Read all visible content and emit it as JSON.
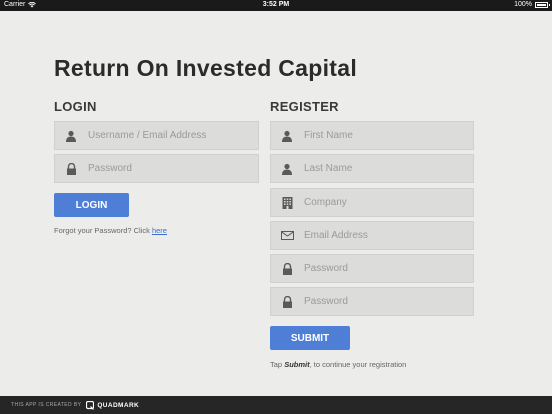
{
  "statusbar": {
    "carrier": "Carrier",
    "time": "3:52 PM",
    "battery": "100%"
  },
  "page": {
    "title": "Return On Invested Capital"
  },
  "login": {
    "heading": "LOGIN",
    "username_placeholder": "Username / Email Address",
    "password_placeholder": "Password",
    "button_label": "LOGIN",
    "forgot_text": "Forgot your Password? Click ",
    "forgot_link": "here"
  },
  "register": {
    "heading": "REGISTER",
    "first_name_placeholder": "First Name",
    "last_name_placeholder": "Last Name",
    "company_placeholder": "Company",
    "email_placeholder": "Email Address",
    "password_placeholder": "Password",
    "confirm_password_placeholder": "Password",
    "button_label": "SUBMIT",
    "hint_prefix": "Tap ",
    "hint_emphasis": "Submit",
    "hint_suffix": ", to continue your registration"
  },
  "footer": {
    "created_by": "THIS APP IS CREATED BY",
    "brand": "QUADMARK"
  },
  "icons": {
    "user": "user-icon",
    "lock": "lock-icon",
    "building": "building-icon",
    "mail": "mail-icon",
    "wifi": "wifi-icon",
    "battery": "battery-icon",
    "brand_logo": "quadmark-logo-icon"
  },
  "colors": {
    "accent": "#4f7ed6",
    "background": "#ececea",
    "field": "#dcdcdb",
    "footer": "#262626"
  }
}
